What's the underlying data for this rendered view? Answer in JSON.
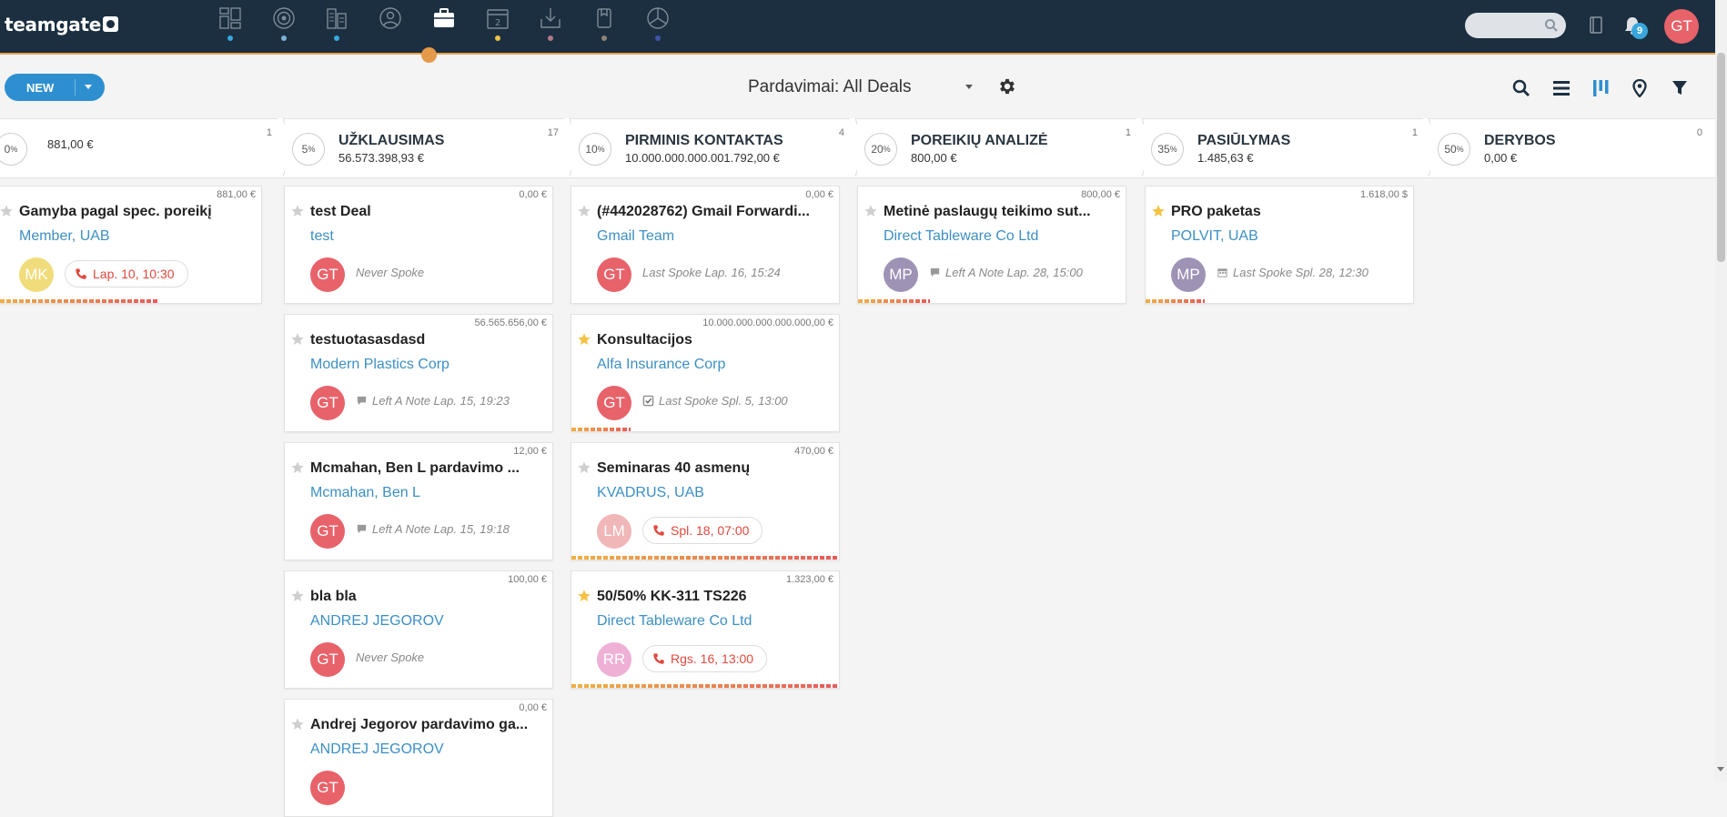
{
  "app": {
    "logo_text": "teamgate"
  },
  "nav": {
    "icons": [
      {
        "name": "dashboard-icon",
        "dot_color": "#3aa7dc"
      },
      {
        "name": "target-icon",
        "dot_color": "#7fb3d8"
      },
      {
        "name": "companies-icon",
        "dot_color": "#3aa7dc"
      },
      {
        "name": "contacts-icon",
        "dot_color": ""
      },
      {
        "name": "deals-briefcase-icon",
        "dot_color": ""
      },
      {
        "name": "calendar-icon",
        "dot_color": "#e8c547",
        "label": "2"
      },
      {
        "name": "inbox-download-icon",
        "dot_color": "#b07a8a"
      },
      {
        "name": "documents-icon",
        "dot_color": "#8d8478"
      },
      {
        "name": "reports-pie-icon",
        "dot_color": "#3a55a8"
      }
    ],
    "search_placeholder": "",
    "notifications_count": "9",
    "user_initials": "GT",
    "user_color": "#e8626a"
  },
  "toolbar": {
    "new_label": "NEW",
    "view_title": "Pardavimai: All Deals"
  },
  "stages": [
    {
      "pct": "0",
      "name": "",
      "amount": "881,00 €",
      "count": "1"
    },
    {
      "pct": "5",
      "name": "UŽKLAUSIMAS",
      "amount": "56.573.398,93 €",
      "count": "17"
    },
    {
      "pct": "10",
      "name": "PIRMINIS KONTAKTAS",
      "amount": "10.000.000.000.001.792,00 €",
      "count": "4"
    },
    {
      "pct": "20",
      "name": "POREIKIŲ ANALIZĖ",
      "amount": "800,00 €",
      "count": "1"
    },
    {
      "pct": "35",
      "name": "PASIŪLYMAS",
      "amount": "1.485,63 €",
      "count": "1"
    },
    {
      "pct": "50",
      "name": "DERYBOS",
      "amount": "0,00 €",
      "count": "0"
    }
  ],
  "columns": [
    [
      {
        "amount": "881,00 €",
        "starred": false,
        "title": "Gamyba pagal spec. poreikį",
        "company": "Member, UAB",
        "avatar": "MK",
        "avatar_color": "#f1dc7c",
        "kind": "pill",
        "pill_type": "phone",
        "activity": "Lap. 10, 10:30",
        "progress": 0.62,
        "progress_color": "#f0b142"
      }
    ],
    [
      {
        "amount": "0,00 €",
        "starred": false,
        "title": "test Deal",
        "company": "test",
        "avatar": "GT",
        "avatar_color": "#e8626a",
        "kind": "text",
        "icon": "",
        "activity": "Never Spoke",
        "progress": 0,
        "progress_color": "#f0b142"
      },
      {
        "amount": "56.565.656,00 €",
        "starred": false,
        "title": "testuotasasdasd",
        "company": "Modern Plastics Corp",
        "avatar": "GT",
        "avatar_color": "#e8626a",
        "kind": "text",
        "icon": "note",
        "activity": "Left A Note Lap. 15, 19:23",
        "progress": 0,
        "progress_color": "#f0b142"
      },
      {
        "amount": "12,00 €",
        "starred": false,
        "title": "Mcmahan, Ben L pardavimo ...",
        "company": "Mcmahan, Ben L",
        "avatar": "GT",
        "avatar_color": "#e8626a",
        "kind": "text",
        "icon": "note",
        "activity": "Left A Note Lap. 15, 19:18",
        "progress": 0,
        "progress_color": "#f0b142"
      },
      {
        "amount": "100,00 €",
        "starred": false,
        "title": "bla bla",
        "company": "ANDREJ JEGOROV",
        "avatar": "GT",
        "avatar_color": "#e8626a",
        "kind": "text",
        "icon": "",
        "activity": "Never Spoke",
        "progress": 0,
        "progress_color": "#f0b142"
      },
      {
        "amount": "0,00 €",
        "starred": false,
        "title": "Andrej Jegorov pardavimo ga...",
        "company": "ANDREJ JEGOROV",
        "avatar": "GT",
        "avatar_color": "#e8626a",
        "kind": "text",
        "icon": "",
        "activity": "",
        "progress": 0,
        "progress_color": "#f0b142"
      }
    ],
    [
      {
        "amount": "0,00 €",
        "starred": false,
        "title": "(#442028762) Gmail Forwardi...",
        "company": "Gmail Team",
        "avatar": "GT",
        "avatar_color": "#e8626a",
        "kind": "text",
        "icon": "",
        "activity": "Last Spoke Lap. 16, 15:24",
        "progress": 0,
        "progress_color": "#f0b142"
      },
      {
        "amount": "10.000.000.000.000.000,00 €",
        "starred": true,
        "title": "Konsultacijos",
        "company": "Alfa Insurance Corp",
        "avatar": "GT",
        "avatar_color": "#e8626a",
        "kind": "text",
        "icon": "check",
        "activity": "Last Spoke Spl. 5, 13:00",
        "progress": 0.22,
        "progress_color": "#f0b142"
      },
      {
        "amount": "470,00 €",
        "starred": false,
        "title": "Seminaras 40 asmenų",
        "company": "KVADRUS, UAB",
        "avatar": "LM",
        "avatar_color": "#f0b6b8",
        "kind": "pill",
        "pill_type": "phone",
        "activity": "Spl. 18, 07:00",
        "progress": 1.0,
        "progress_color": "#f0b142"
      },
      {
        "amount": "1.323,00 €",
        "starred": true,
        "title": "50/50% KK-311 TS226",
        "company": "Direct Tableware Co Ltd",
        "avatar": "RR",
        "avatar_color": "#efb0d6",
        "kind": "pill",
        "pill_type": "phone",
        "activity": "Rgs. 16, 13:00",
        "progress": 1.0,
        "progress_color": "#f0b142"
      }
    ],
    [
      {
        "amount": "800,00 €",
        "starred": false,
        "title": "Metinė paslaugų teikimo sut...",
        "company": "Direct Tableware Co Ltd",
        "avatar": "MP",
        "avatar_color": "#9e92b5",
        "kind": "text",
        "icon": "note",
        "activity": "Left A Note Lap. 28, 15:00",
        "progress": 0.27,
        "progress_color": "#f0b142"
      }
    ],
    [
      {
        "amount": "1.618,00 $",
        "starred": true,
        "title": "PRO paketas",
        "company": "POLVIT, UAB",
        "avatar": "MP",
        "avatar_color": "#9e92b5",
        "kind": "text",
        "icon": "calendar",
        "activity": "Last Spoke Spl. 28, 12:30",
        "progress": 0.22,
        "progress_color": "#f0b142"
      }
    ]
  ]
}
